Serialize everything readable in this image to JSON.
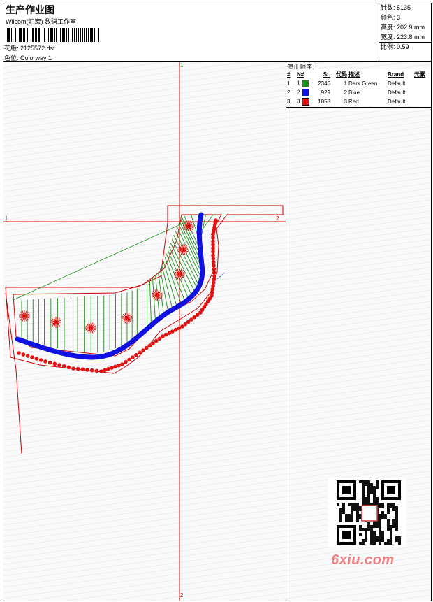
{
  "header": {
    "title": "生产作业图",
    "company": "Wilcom(汇宏) 数码工作室",
    "design": {
      "label": "花版:",
      "value": "2125572.dst"
    },
    "colorway": {
      "label": "色位:",
      "value": "Colorway 1"
    }
  },
  "stats": [
    {
      "label": "针数:",
      "value": "5135"
    },
    {
      "label": "颜色:",
      "value": "3"
    },
    {
      "label": "高度:",
      "value": "202.9 mm"
    },
    {
      "label": "宽度:",
      "value": "223.8 mm"
    },
    {
      "label": "比例:",
      "value": "0.59"
    }
  ],
  "stop_sequence": {
    "title": "停止顺序:",
    "columns": [
      "#",
      "N#",
      "St.",
      "代码",
      "描述",
      "Brand",
      "元素"
    ],
    "rows": [
      {
        "index": "1.",
        "n": "1",
        "stitches": "2346",
        "code": "1",
        "description": "Dark Green",
        "brand": "Default",
        "color": "#1a8f1a"
      },
      {
        "index": "2.",
        "n": "2",
        "stitches": "929",
        "code": "2",
        "description": "Blue",
        "brand": "Default",
        "color": "#1010e0"
      },
      {
        "index": "3.",
        "n": "3",
        "stitches": "1858",
        "code": "3",
        "description": "Red",
        "brand": "Default",
        "color": "#e01010"
      }
    ]
  },
  "axes": {
    "top": "1",
    "bottom": "2",
    "left": "1",
    "right": "2"
  },
  "watermark": {
    "text": "6xiu.com",
    "seal": "汉印网址"
  },
  "colors": {
    "outline": "#cc0000",
    "crosshair": "#d00000",
    "satin_green": "#1a8f1a",
    "satin_blue": "#1010e0",
    "stitch_red": "#e01010"
  }
}
